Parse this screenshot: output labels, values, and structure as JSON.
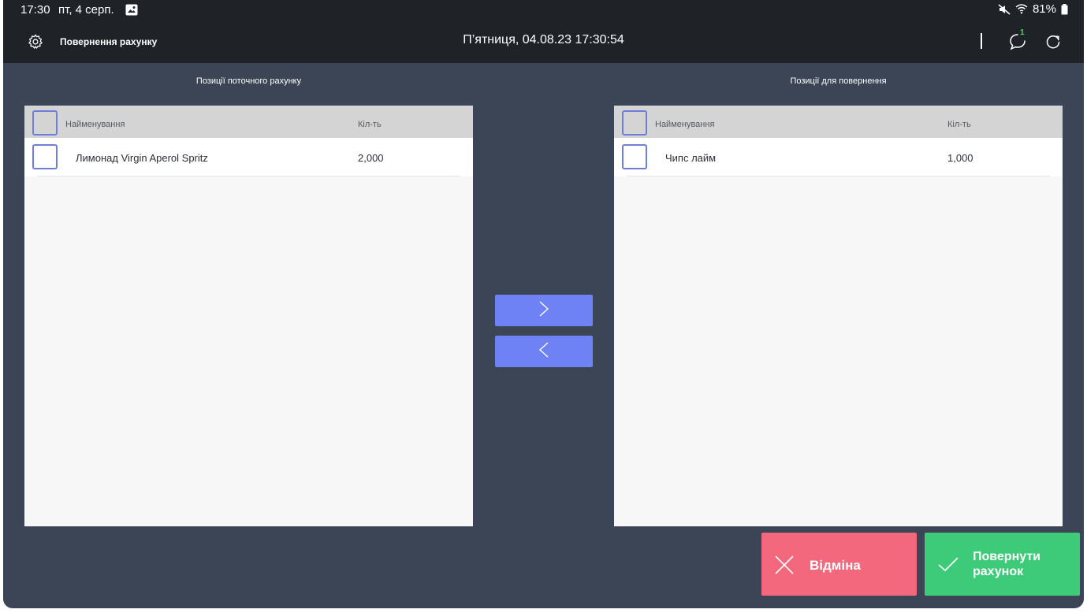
{
  "status_bar": {
    "time": "17:30",
    "date": "пт, 4 серп.",
    "battery": "81%",
    "icons": [
      "gallery-icon",
      "mute-icon",
      "wifi-icon",
      "battery-icon"
    ]
  },
  "header": {
    "title": "Повернення рахунку",
    "datetime": "П’ятниця, 04.08.23 17:30:54",
    "chat_badge": "1",
    "icons": [
      "gear-icon",
      "chat-icon",
      "refresh-icon"
    ]
  },
  "left_panel": {
    "title": "Позиції поточного рахунку",
    "columns": {
      "name": "Найменування",
      "qty": "Кіл-ть"
    },
    "rows": [
      {
        "name": "Лимонад Virgin Aperol Spritz",
        "qty": "2,000"
      }
    ]
  },
  "right_panel": {
    "title": "Позиції для повернення",
    "columns": {
      "name": "Найменування",
      "qty": "Кіл-ть"
    },
    "rows": [
      {
        "name": "Чипс лайм",
        "qty": "1,000"
      }
    ]
  },
  "transfer": {
    "move_right_icon": "chevron-right-icon",
    "move_left_icon": "chevron-left-icon"
  },
  "actions": {
    "cancel_label": "Відміна",
    "confirm_label": "Повернути рахунок"
  },
  "colors": {
    "background": "#3c4555",
    "header": "#1f2328",
    "accent": "#6e82f5",
    "cancel": "#f3687d",
    "confirm": "#3ecb79"
  }
}
